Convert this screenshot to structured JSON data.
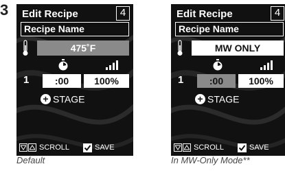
{
  "step_number": "3",
  "screens": [
    {
      "header_title": "Edit Recipe",
      "header_number": "4",
      "recipe_name": "Recipe Name",
      "temperature": "475˚F",
      "stage_number": "1",
      "time": ":00",
      "power": "100%",
      "add_stage_label": "STAGE",
      "scroll_label": "SCROLL",
      "save_label": "SAVE",
      "caption": "Default"
    },
    {
      "header_title": "Edit Recipe",
      "header_number": "4",
      "recipe_name": "Recipe Name",
      "temperature": "MW ONLY",
      "stage_number": "1",
      "time": ":00",
      "power": "100%",
      "add_stage_label": "STAGE",
      "scroll_label": "SCROLL",
      "save_label": "SAVE",
      "caption": "In MW-Only Mode**"
    }
  ],
  "icons": {
    "thermometer": "thermometer-icon",
    "timer": "stopwatch-icon",
    "power": "signal-bars-icon",
    "add": "plus-circle-icon",
    "scroll_down": "down-arrow-icon",
    "scroll_up": "up-arrow-icon",
    "save": "checkmark-icon"
  },
  "colors": {
    "screen_bg": "#111111",
    "highlight_gray": "#8a8a8a",
    "field_white": "#ffffff"
  }
}
